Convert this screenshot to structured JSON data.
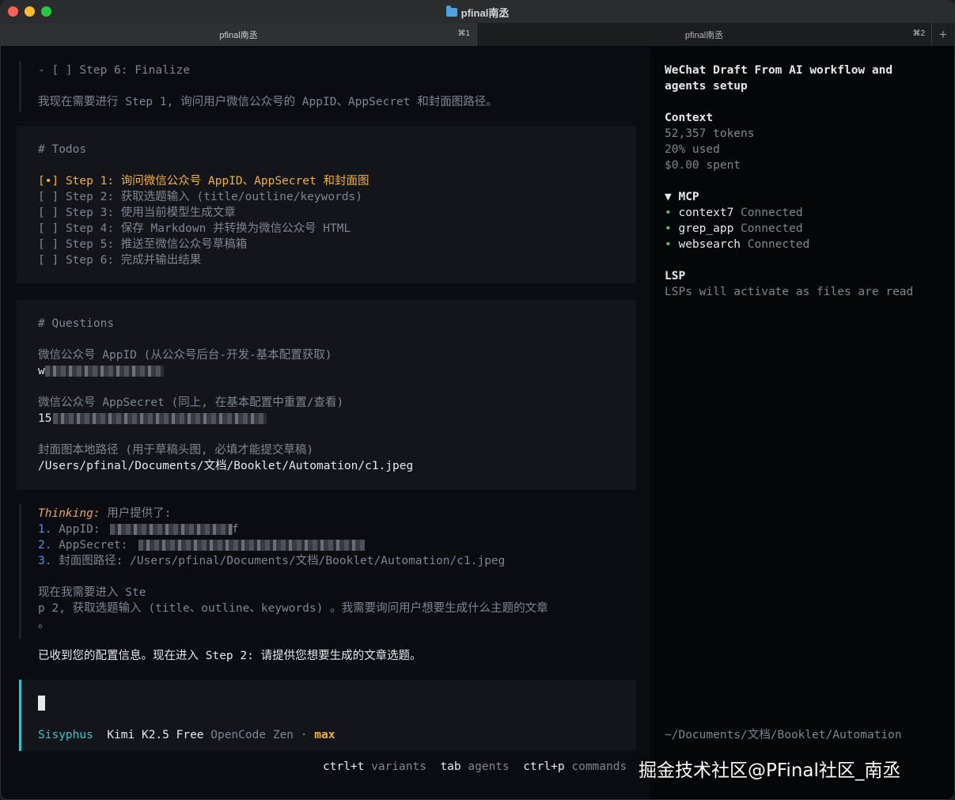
{
  "window": {
    "title": "pfinal南丞",
    "tabs": [
      {
        "label": "pfinal南丞",
        "shortcut": "⌘1"
      },
      {
        "label": "pfinal南丞",
        "shortcut": "⌘2"
      }
    ],
    "add_tab": "+"
  },
  "main": {
    "top_todo": "- [ ] Step 6: Finalize",
    "intro": "我现在需要进行 Step 1, 询问用户微信公众号的 AppID、AppSecret 和封面图路径。",
    "todos": {
      "heading": "# Todos",
      "items": [
        {
          "mark": "[•]",
          "text": "Step 1: 询问微信公众号 AppID、AppSecret 和封面图"
        },
        {
          "mark": "[ ]",
          "text": "Step 2: 获取选题输入 (title/outline/keywords)"
        },
        {
          "mark": "[ ]",
          "text": "Step 3: 使用当前模型生成文章"
        },
        {
          "mark": "[ ]",
          "text": "Step 4: 保存 Markdown 并转换为微信公众号 HTML"
        },
        {
          "mark": "[ ]",
          "text": "Step 5: 推送至微信公众号草稿箱"
        },
        {
          "mark": "[ ]",
          "text": "Step 6: 完成并输出结果"
        }
      ]
    },
    "questions": {
      "heading": "# Questions",
      "q1_label": "微信公众号 AppID (从公众号后台-开发-基本配置获取)",
      "q1_answer_prefix": "w",
      "q2_label": "微信公众号 AppSecret (同上, 在基本配置中重置/查看)",
      "q2_answer_prefix": "15",
      "q3_label": "封面图本地路径 (用于草稿头图, 必填才能提交草稿)",
      "q3_answer": "/Users/pfinal/Documents/文档/Booklet/Automation/c1.jpeg"
    },
    "thinking": {
      "label": "Thinking:",
      "text": " 用户提供了:",
      "items": [
        {
          "num": "1.",
          "label": "AppID: ",
          "suffix": "f"
        },
        {
          "num": "2.",
          "label": "AppSecret: ",
          "suffix": ""
        },
        {
          "num": "3.",
          "label": "封面图路径: /Users/pfinal/Documents/文档/Booklet/Automation/c1.jpeg",
          "suffix": ""
        }
      ],
      "para1": "现在我需要进入 Ste",
      "para2": "p 2, 获取选题输入 (title、outline、keywords) 。我需要询问用户想要生成什么主题的文章",
      "para3": "。"
    },
    "reply": "已收到您的配置信息。现在进入 Step 2: 请提供您想要生成的文章选题。",
    "prompt": {
      "agent": "Sisyphus",
      "model": "Kimi K2.5 Free",
      "provider": "OpenCode Zen",
      "separator": "·",
      "variant": "max"
    },
    "footer": {
      "k1": "ctrl+t",
      "v1": "variants",
      "k2": "tab",
      "v2": "agents",
      "k3": "ctrl+p",
      "v3": "commands"
    }
  },
  "sidebar": {
    "title_line1": "WeChat Draft From AI workflow and",
    "title_line2": "agents setup",
    "context": {
      "heading": "Context",
      "tokens": "52,357 tokens",
      "used": "20% used",
      "spent": "$0.00 spent"
    },
    "mcp": {
      "heading": "MCP",
      "arrow": "▼",
      "servers": [
        {
          "name": "context7",
          "status": "Connected"
        },
        {
          "name": "grep_app",
          "status": "Connected"
        },
        {
          "name": "websearch",
          "status": "Connected"
        }
      ]
    },
    "lsp": {
      "heading": "LSP",
      "text": "LSPs will activate as files are read"
    },
    "cwd": "~/Documents/文档/Booklet/Automation"
  },
  "watermark": "掘金技术社区@PFinal社区_南丞",
  "colors": {
    "accent_cyan": "#36c2c9",
    "todo_active": "#f0b232",
    "list_number": "#5b8fd6",
    "status_green": "#48c774"
  }
}
